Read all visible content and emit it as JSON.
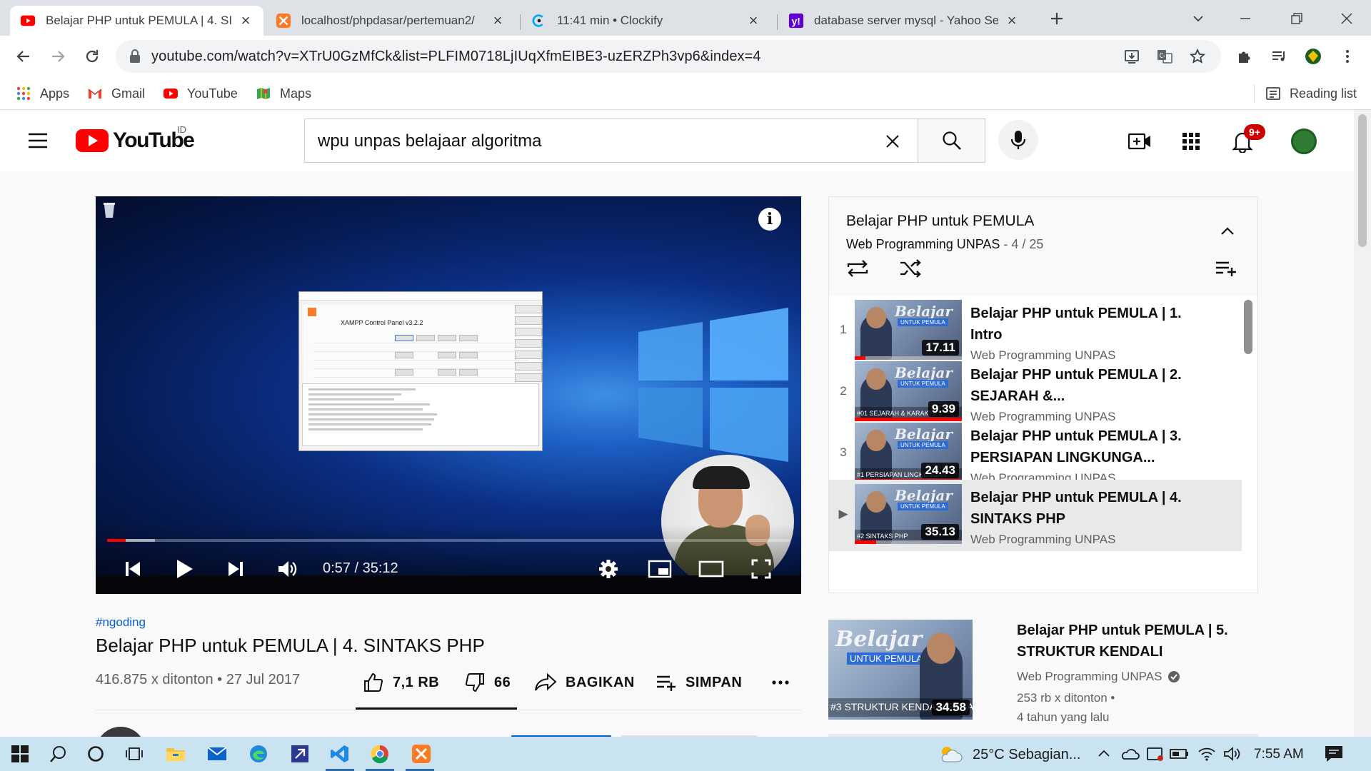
{
  "browser": {
    "tabs": [
      {
        "title": "Belajar PHP untuk PEMULA | 4. SI",
        "icon": "youtube-icon",
        "active": true
      },
      {
        "title": "localhost/phpdasar/pertemuan2/",
        "icon": "xampp-icon",
        "active": false
      },
      {
        "title": "11:41 min • Clockify",
        "icon": "clockify-icon",
        "active": false
      },
      {
        "title": "database server mysql - Yahoo Se",
        "icon": "yahoo-icon",
        "active": false
      }
    ],
    "url": "youtube.com/watch?v=XTrU0GzMfCk&list=PLFIM0718LjIUqXfmEIBE3-uzERZPh3vp6&index=4",
    "bookmarks": [
      {
        "label": "Apps",
        "icon": "apps-grid-icon"
      },
      {
        "label": "Gmail",
        "icon": "gmail-icon"
      },
      {
        "label": "YouTube",
        "icon": "youtube-icon"
      },
      {
        "label": "Maps",
        "icon": "maps-icon"
      }
    ],
    "reading_list": "Reading list"
  },
  "youtube": {
    "logo_text": "YouTube",
    "country": "ID",
    "search_query": "wpu unpas belajaar algoritma",
    "notifications_badge": "9+",
    "colors": {
      "brand_red": "#ff0000",
      "link_blue": "#065fd4"
    }
  },
  "player": {
    "current_time": "0:57",
    "duration": "35:12",
    "time_display": "0:57 / 35:12",
    "progress_fraction": 0.027,
    "embedded_window_title": "XAMPP Control Panel v3.2.2"
  },
  "video": {
    "hashtag": "#ngoding",
    "title": "Belajar PHP untuk PEMULA | 4. SINTAKS PHP",
    "views_date": "416.875 x ditonton • 27 Jul 2017",
    "likes": "7,1 RB",
    "dislikes": "66",
    "share_label": "BAGIKAN",
    "save_label": "SIMPAN"
  },
  "playlist": {
    "title": "Belajar PHP untuk PEMULA",
    "channel": "Web Programming UNPAS",
    "position": " - 4 / 25",
    "items": [
      {
        "index": "1",
        "title": "Belajar PHP untuk PEMULA | 1. Intro",
        "channel": "Web Programming UNPAS",
        "duration": "17.11",
        "thumb_caption": "",
        "progress": 0.1,
        "current": false
      },
      {
        "index": "2",
        "title": "Belajar PHP untuk PEMULA | 2. SEJARAH &...",
        "channel": "Web Programming UNPAS",
        "duration": "9.39",
        "thumb_caption": "#01 SEJARAH & KARAKTE",
        "progress": 1.0,
        "current": false
      },
      {
        "index": "3",
        "title": "Belajar PHP untuk PEMULA | 3. PERSIAPAN LINGKUNGA...",
        "channel": "Web Programming UNPAS",
        "duration": "24.43",
        "thumb_caption": "#1 PERSIAPAN LINGKUNGAN",
        "progress": 1.0,
        "current": false
      },
      {
        "index": "▶",
        "title": "Belajar PHP untuk PEMULA | 4. SINTAKS PHP",
        "channel": "Web Programming UNPAS",
        "duration": "35.13",
        "thumb_caption": "#2 SINTAKS PHP",
        "progress": 0.2,
        "current": true
      }
    ]
  },
  "up_next": {
    "title": "Belajar PHP untuk PEMULA | 5. STRUKTUR KENDALI",
    "channel": "Web Programming UNPAS",
    "views": "253 rb x ditonton •",
    "age": "4 tahun yang lalu",
    "duration": "34.58",
    "thumb_caption": "#3 STRUKTUR KENDALI PADA"
  },
  "taskbar": {
    "weather": "25°C  Sebagian...",
    "clock": "7:55 AM"
  }
}
